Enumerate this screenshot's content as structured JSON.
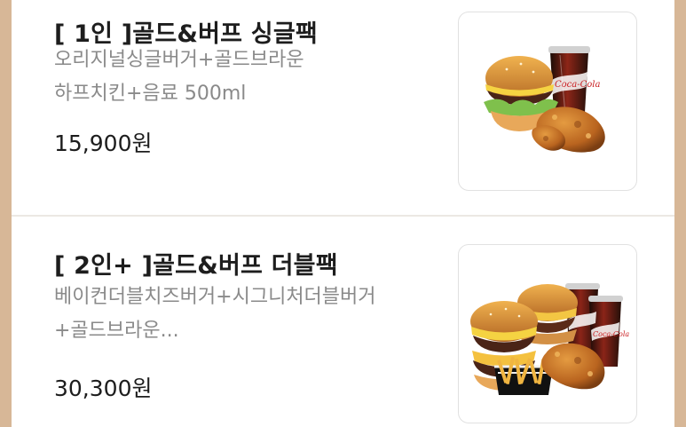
{
  "menu_items": [
    {
      "title": "[ 1인 ]골드&버프 싱글팩",
      "description_line1": "오리지널싱글버거+골드브라운",
      "description_line2": "하프치킨+음료 500ml",
      "price": "15,900원",
      "image_icon": "burger-chicken-drink-photo",
      "cup_text": "Coca-Cola"
    },
    {
      "title": "[ 2인+ ]골드&버프 더블팩",
      "description_line1": "베이컨더블치즈버거+시그니처더블버거",
      "description_line2": "+골드브라운...",
      "price": "30,300원",
      "image_icon": "double-burger-fries-chicken-drinks-photo",
      "cup_text": "Coca-Cola"
    }
  ],
  "colors": {
    "background": "#d7b797",
    "card": "#ffffff",
    "title": "#1d1d1d",
    "description": "#8a8a8a",
    "divider": "#ece8e3"
  }
}
